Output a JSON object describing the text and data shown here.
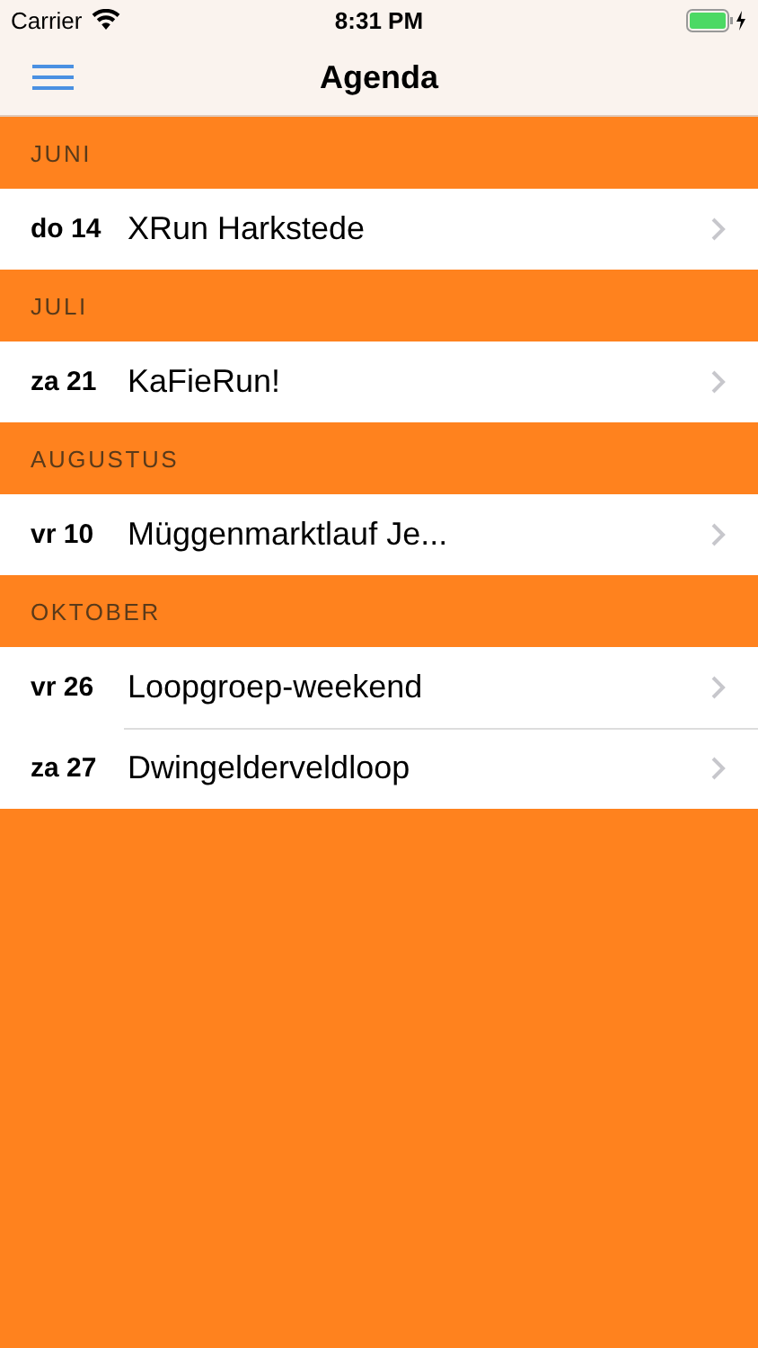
{
  "status_bar": {
    "carrier": "Carrier",
    "time": "8:31 PM"
  },
  "nav_bar": {
    "title": "Agenda"
  },
  "sections": [
    {
      "title": "JUNI",
      "events": [
        {
          "date": "do 14",
          "name": "XRun Harkstede"
        }
      ]
    },
    {
      "title": "JULI",
      "events": [
        {
          "date": "za 21",
          "name": "KaFieRun!"
        }
      ]
    },
    {
      "title": "AUGUSTUS",
      "events": [
        {
          "date": "vr 10",
          "name": "Müggenmarktlauf Je..."
        }
      ]
    },
    {
      "title": "OKTOBER",
      "events": [
        {
          "date": "vr 26",
          "name": "Loopgroep-weekend"
        },
        {
          "date": "za 27",
          "name": "Dwingelderveldloop"
        }
      ]
    }
  ]
}
